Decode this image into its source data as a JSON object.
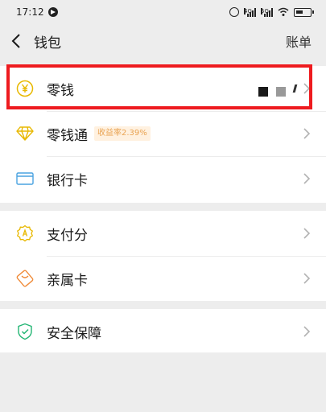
{
  "status_bar": {
    "time": "17:12",
    "signal_1_label": "4G",
    "signal_2_label": "5G"
  },
  "header": {
    "title": "钱包",
    "action_label": "账单"
  },
  "wallet_items": [
    {
      "label": "零钱",
      "icon": "yuan-coin-icon"
    },
    {
      "label": "零钱通",
      "badge": "收益率2.39%",
      "icon": "diamond-icon"
    },
    {
      "label": "银行卡",
      "icon": "bank-card-icon"
    }
  ],
  "services": [
    {
      "label": "支付分",
      "icon": "credit-score-icon"
    },
    {
      "label": "亲属卡",
      "icon": "family-card-icon"
    }
  ],
  "security": [
    {
      "label": "安全保障",
      "icon": "shield-check-icon"
    }
  ],
  "colors": {
    "background": "#ededed",
    "highlight": "#ee1b1f",
    "coin": "#e8b800",
    "bank_card": "#4aa3e0",
    "family_card": "#f08c3a",
    "shield": "#22b573",
    "badge_text": "#e9a352"
  }
}
